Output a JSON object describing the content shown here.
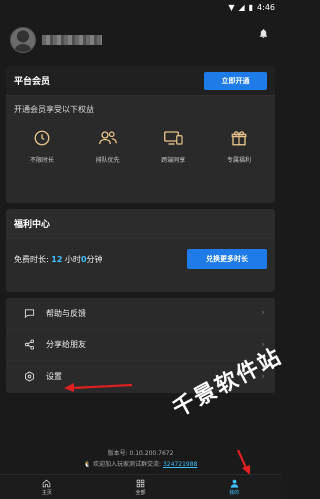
{
  "status": {
    "time": "4:46"
  },
  "vip": {
    "title": "平台会员",
    "open_button": "立即开通",
    "subtitle": "开通会员享受以下权益",
    "benefits": [
      {
        "label": "不限时长",
        "icon": "clock-icon"
      },
      {
        "label": "排队优先",
        "icon": "users-icon"
      },
      {
        "label": "跨端同享",
        "icon": "devices-icon"
      },
      {
        "label": "专属福利",
        "icon": "gift-icon"
      }
    ]
  },
  "welfare": {
    "title": "福利中心",
    "free_prefix": "免费时长: ",
    "hours": "12",
    "hour_unit": " 小时",
    "minutes": "0",
    "minute_unit": "分钟",
    "exchange_button": "兑换更多时长"
  },
  "menu": {
    "items": [
      {
        "label": "帮助与反馈",
        "icon": "chat-icon"
      },
      {
        "label": "分享给朋友",
        "icon": "share-icon"
      },
      {
        "label": "设置",
        "icon": "gear-icon"
      }
    ]
  },
  "footer": {
    "version": "版本号: 0.10.200.7672",
    "join_text": "欢迎加入玩家测试群交流: ",
    "qq": "324721988"
  },
  "nav": {
    "tabs": [
      {
        "label": "主页",
        "icon": "home-icon"
      },
      {
        "label": "全部",
        "icon": "grid-icon"
      },
      {
        "label": "我的",
        "icon": "person-icon"
      }
    ],
    "active": 2
  },
  "watermark": "千景软件站",
  "colors": {
    "accent": "#1f7be8",
    "highlight": "#41c0ff",
    "arrow": "#e02020"
  }
}
